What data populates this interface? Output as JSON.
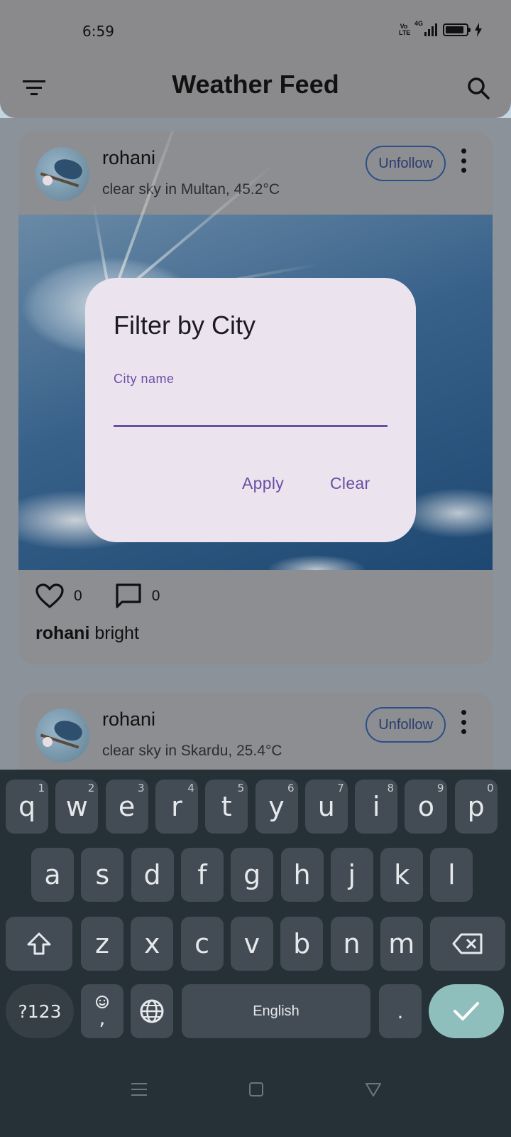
{
  "status_bar": {
    "time": "6:59",
    "volte": "Vo LTE",
    "network": "4G",
    "battery_percent": 90
  },
  "app_bar": {
    "title": "Weather Feed"
  },
  "feed": {
    "posts": [
      {
        "username": "rohani",
        "subtitle": "clear sky in Multan, 45.2°C",
        "follow_label": "Unfollow",
        "likes": "0",
        "comments": "0",
        "caption_user": "rohani",
        "caption_text": " bright"
      },
      {
        "username": "rohani",
        "subtitle": "clear sky in Skardu, 25.4°C",
        "follow_label": "Unfollow"
      }
    ]
  },
  "dialog": {
    "title": "Filter by City",
    "field_label": "City name",
    "field_value": "",
    "apply_label": "Apply",
    "clear_label": "Clear"
  },
  "keyboard": {
    "row1": [
      {
        "k": "q",
        "n": "1"
      },
      {
        "k": "w",
        "n": "2"
      },
      {
        "k": "e",
        "n": "3"
      },
      {
        "k": "r",
        "n": "4"
      },
      {
        "k": "t",
        "n": "5"
      },
      {
        "k": "y",
        "n": "6"
      },
      {
        "k": "u",
        "n": "7"
      },
      {
        "k": "i",
        "n": "8"
      },
      {
        "k": "o",
        "n": "9"
      },
      {
        "k": "p",
        "n": "0"
      }
    ],
    "row2": [
      "a",
      "s",
      "d",
      "f",
      "g",
      "h",
      "j",
      "k",
      "l"
    ],
    "row3": [
      "z",
      "x",
      "c",
      "v",
      "b",
      "n",
      "m"
    ],
    "symbols_label": "?123",
    "comma_label": ",",
    "space_label": "English",
    "period_label": "."
  },
  "icons": {
    "filter": "filter-icon",
    "search": "search-icon",
    "like": "heart-icon",
    "comment": "comment-icon",
    "more": "more-vert-icon",
    "shift": "shift-icon",
    "backspace": "backspace-icon",
    "globe": "globe-icon",
    "emoji": "emoji-icon",
    "enter": "check-icon",
    "nav_menu": "menu-icon",
    "nav_home": "home-icon",
    "nav_back": "back-icon"
  }
}
